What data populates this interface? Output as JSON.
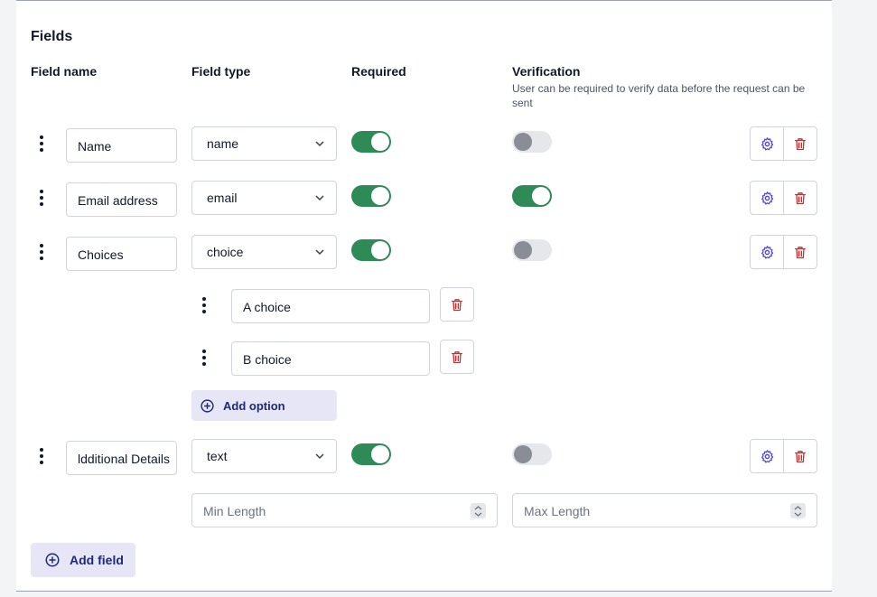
{
  "section": {
    "title": "Fields"
  },
  "columns": {
    "field_name": "Field name",
    "field_type": "Field type",
    "required": "Required",
    "verification": "Verification",
    "verification_help": "User can be required to verify data before the request can be sent"
  },
  "fields": [
    {
      "name": "Name",
      "type": "name",
      "required": true,
      "verification": false
    },
    {
      "name": "Email address",
      "type": "email",
      "required": true,
      "verification": true
    },
    {
      "name": "Choices",
      "type": "choice",
      "required": true,
      "verification": false,
      "options": [
        "A choice",
        "B choice"
      ]
    },
    {
      "name": "Additional Details",
      "name_visible": "ldditional Details",
      "type": "text",
      "required": true,
      "verification": false,
      "min_length_placeholder": "Min Length",
      "max_length_placeholder": "Max Length"
    }
  ],
  "buttons": {
    "add_option": "Add option",
    "add_field": "Add field"
  },
  "colors": {
    "toggle_on": "#2e8b57",
    "toggle_off": "#e5e7eb",
    "settings_icon": "#4f46e5",
    "delete_icon": "#dc2626",
    "add_button_bg": "#e6e6f7",
    "add_button_text": "#1e2a78"
  },
  "icons": {
    "drag": "drag-handle-icon",
    "settings": "gear-icon",
    "delete": "trash-icon",
    "add": "plus-circle-icon",
    "dropdown": "chevron-down-icon"
  }
}
